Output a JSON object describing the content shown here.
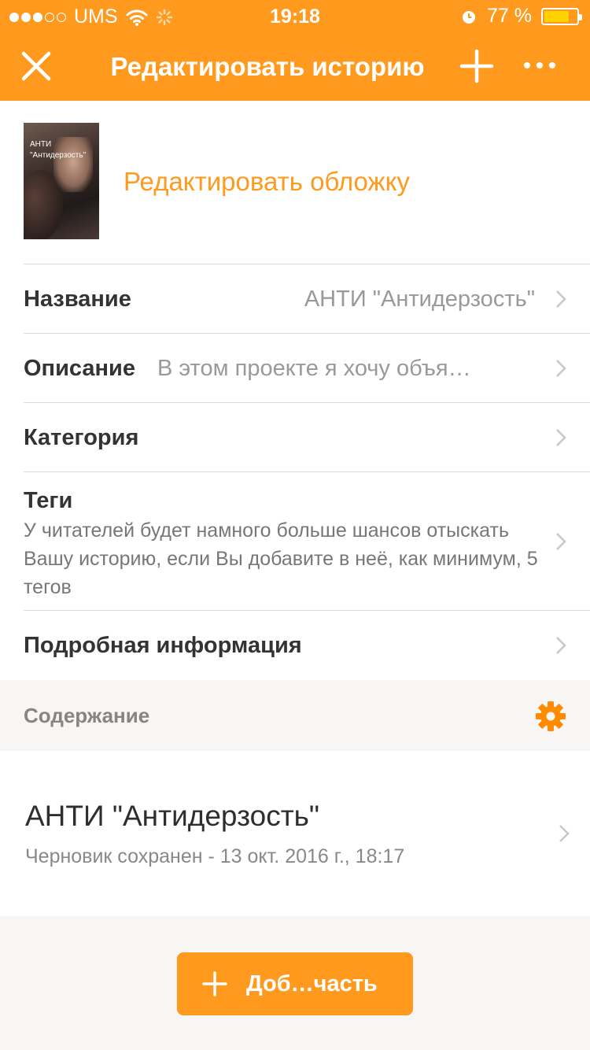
{
  "status_bar": {
    "carrier": "UMS",
    "time": "19:18",
    "battery_percent_text": "77 %",
    "battery_level": 0.77
  },
  "nav": {
    "title": "Редактировать историю",
    "close_icon": "close-icon",
    "plus_icon": "plus-icon",
    "more_icon": "more-icon"
  },
  "cover": {
    "image_text_line1": "АНТИ",
    "image_text_line2": "\"Антидерзость\"",
    "edit_label": "Редактировать обложку"
  },
  "fields": {
    "title_label": "Название",
    "title_value": "АНТИ \"Антидерзость\"",
    "description_label": "Описание",
    "description_value": "В этом проекте я хочу объя…",
    "category_label": "Категория",
    "tags_label": "Теги",
    "tags_hint": "У читателей будет намного больше шансов отыскать Вашу историю, если Вы добавите в неё, как минимум, 5 тегов",
    "details_label": "Подробная информация"
  },
  "contents": {
    "section_label": "Содержание",
    "parts": [
      {
        "title": "АНТИ \"Антидерзость\"",
        "meta": "Черновик сохранен - 13 окт. 2016 г., 18:17"
      }
    ],
    "add_part_label": "Доб…часть"
  },
  "colors": {
    "accent": "#ff9a1f",
    "battery_fill": "#ffd200"
  }
}
